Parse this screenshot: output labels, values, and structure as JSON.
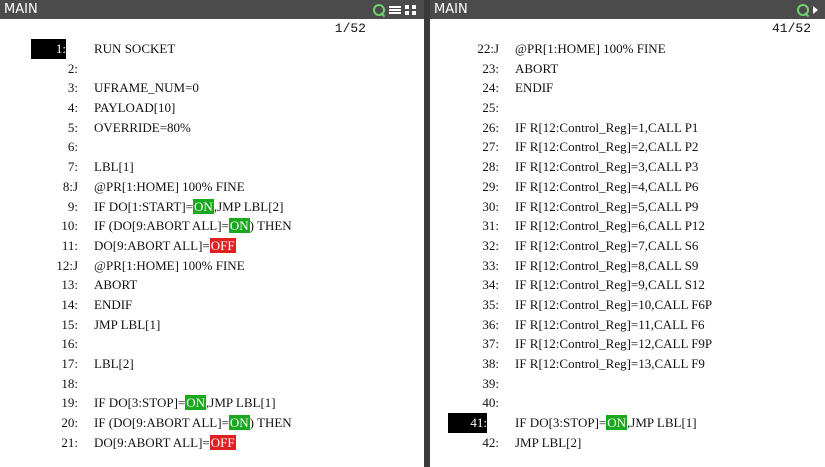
{
  "left": {
    "title": "MAIN",
    "page": "1/52",
    "icons": [
      "search-icon",
      "menu-icon",
      "maximize-icon"
    ],
    "lines": [
      {
        "n": "1:",
        "cursor": true,
        "parts": [
          {
            "t": "RUN SOCKET"
          }
        ]
      },
      {
        "n": "2:",
        "parts": []
      },
      {
        "n": "3:",
        "parts": [
          {
            "t": "UFRAME_NUM=0"
          }
        ]
      },
      {
        "n": "4:",
        "parts": [
          {
            "t": "PAYLOAD[10]"
          }
        ]
      },
      {
        "n": "5:",
        "parts": [
          {
            "t": "OVERRIDE=80%"
          }
        ]
      },
      {
        "n": "6:",
        "parts": []
      },
      {
        "n": "7:",
        "parts": [
          {
            "t": "LBL[1]"
          }
        ]
      },
      {
        "n": "8:J",
        "parts": [
          {
            "t": "@PR[1:HOME] 100% FINE"
          }
        ]
      },
      {
        "n": "9:",
        "parts": [
          {
            "t": "IF DO[1:START]="
          },
          {
            "t": "ON",
            "hl": "on"
          },
          {
            "t": ",JMP LBL[2]"
          }
        ]
      },
      {
        "n": "10:",
        "parts": [
          {
            "t": "IF (DO[9:ABORT ALL]="
          },
          {
            "t": "ON",
            "hl": "on"
          },
          {
            "t": ") THEN"
          }
        ]
      },
      {
        "n": "11:",
        "parts": [
          {
            "t": "DO[9:ABORT ALL]="
          },
          {
            "t": "OFF",
            "hl": "off"
          }
        ]
      },
      {
        "n": "12:J",
        "parts": [
          {
            "t": "@PR[1:HOME] 100% FINE"
          }
        ]
      },
      {
        "n": "13:",
        "parts": [
          {
            "t": "ABORT"
          }
        ]
      },
      {
        "n": "14:",
        "parts": [
          {
            "t": "ENDIF"
          }
        ]
      },
      {
        "n": "15:",
        "parts": [
          {
            "t": "JMP LBL[1]"
          }
        ]
      },
      {
        "n": "16:",
        "parts": []
      },
      {
        "n": "17:",
        "parts": [
          {
            "t": "LBL[2]"
          }
        ]
      },
      {
        "n": "18:",
        "parts": []
      },
      {
        "n": "19:",
        "parts": [
          {
            "t": "IF DO[3:STOP]="
          },
          {
            "t": "ON",
            "hl": "on"
          },
          {
            "t": ",JMP LBL[1]"
          }
        ]
      },
      {
        "n": "20:",
        "parts": [
          {
            "t": "IF (DO[9:ABORT ALL]="
          },
          {
            "t": "ON",
            "hl": "on"
          },
          {
            "t": ") THEN"
          }
        ]
      },
      {
        "n": "21:",
        "parts": [
          {
            "t": "DO[9:ABORT ALL]="
          },
          {
            "t": "OFF",
            "hl": "off"
          }
        ]
      }
    ]
  },
  "right": {
    "title": "MAIN",
    "page": "41/52",
    "icons": [
      "search-icon",
      "next-icon"
    ],
    "lines": [
      {
        "n": "22:J",
        "parts": [
          {
            "t": "@PR[1:HOME] 100% FINE"
          }
        ]
      },
      {
        "n": "23:",
        "parts": [
          {
            "t": "ABORT"
          }
        ]
      },
      {
        "n": "24:",
        "parts": [
          {
            "t": "ENDIF"
          }
        ]
      },
      {
        "n": "25:",
        "parts": []
      },
      {
        "n": "26:",
        "parts": [
          {
            "t": "IF R[12:Control_Reg]=1,CALL P1"
          }
        ]
      },
      {
        "n": "27:",
        "parts": [
          {
            "t": "IF R[12:Control_Reg]=2,CALL P2"
          }
        ]
      },
      {
        "n": "28:",
        "parts": [
          {
            "t": "IF R[12:Control_Reg]=3,CALL P3"
          }
        ]
      },
      {
        "n": "29:",
        "parts": [
          {
            "t": "IF R[12:Control_Reg]=4,CALL P6"
          }
        ]
      },
      {
        "n": "30:",
        "parts": [
          {
            "t": "IF R[12:Control_Reg]=5,CALL P9"
          }
        ]
      },
      {
        "n": "31:",
        "parts": [
          {
            "t": "IF R[12:Control_Reg]=6,CALL P12"
          }
        ]
      },
      {
        "n": "32:",
        "parts": [
          {
            "t": "IF R[12:Control_Reg]=7,CALL S6"
          }
        ]
      },
      {
        "n": "33:",
        "parts": [
          {
            "t": "IF R[12:Control_Reg]=8,CALL S9"
          }
        ]
      },
      {
        "n": "34:",
        "parts": [
          {
            "t": "IF R[12:Control_Reg]=9,CALL S12"
          }
        ]
      },
      {
        "n": "35:",
        "parts": [
          {
            "t": "IF R[12:Control_Reg]=10,CALL F6P"
          }
        ]
      },
      {
        "n": "36:",
        "parts": [
          {
            "t": "IF R[12:Control_Reg]=11,CALL F6"
          }
        ]
      },
      {
        "n": "37:",
        "parts": [
          {
            "t": "IF R[12:Control_Reg]=12,CALL F9P"
          }
        ]
      },
      {
        "n": "38:",
        "parts": [
          {
            "t": "IF R[12:Control_Reg]=13,CALL F9"
          }
        ]
      },
      {
        "n": "39:",
        "parts": []
      },
      {
        "n": "40:",
        "parts": []
      },
      {
        "n": "41:",
        "cursor": true,
        "parts": [
          {
            "t": "IF DO[3:STOP]="
          },
          {
            "t": "ON",
            "hl": "on"
          },
          {
            "t": ",JMP LBL[1]"
          }
        ]
      },
      {
        "n": "42:",
        "parts": [
          {
            "t": "JMP LBL[2]"
          }
        ]
      }
    ]
  },
  "colors": {
    "titlebar_bg": "#4b4b4b",
    "on_highlight": "#19a81e",
    "off_highlight": "#e02020",
    "cursor": "#000000"
  }
}
